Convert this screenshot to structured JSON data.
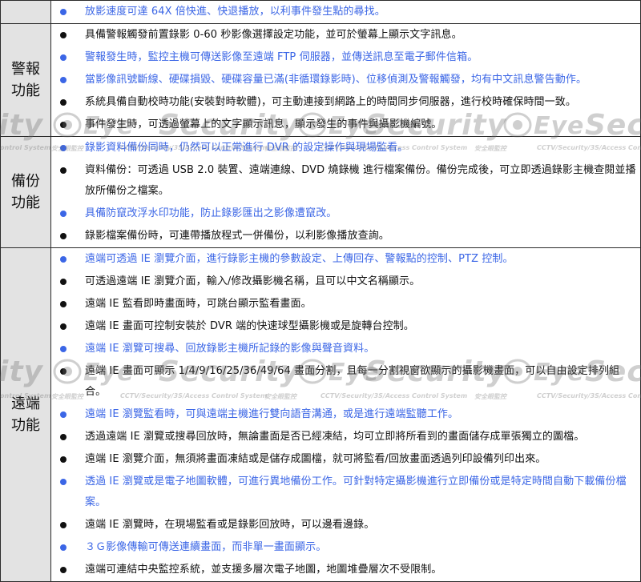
{
  "rows": [
    {
      "category": "",
      "items": [
        {
          "text": "放影速度可達 64X 倍快進、快退播放，以利事件發生點的尋找。",
          "color": "blue"
        }
      ]
    },
    {
      "category": "警報功能",
      "items": [
        {
          "text": "具備警報觸發前置錄影 0-60 秒影像選擇設定功能，並可於螢幕上顯示文字訊息。",
          "color": "black"
        },
        {
          "text": "警報發生時，監控主機可傳送影像至遠端 FTP 伺服器，並傳送訊息至電子郵件信箱。",
          "color": "blue"
        },
        {
          "text": "當影像訊號斷線、硬碟損毀、硬碟容量已滿(非循環錄影時)、位移偵測及警報觸發，均有中文訊息警告動作。",
          "color": "blue"
        },
        {
          "text": "系統具備自動校時功能(安裝對時軟體)，可主動連接到網路上的時間同步伺服器，進行校時確保時間一致。",
          "color": "black"
        },
        {
          "text": "事件發生時，可透過螢幕上的文字顯示訊息，顯示發生的事件與攝影機編號。",
          "color": "black"
        }
      ]
    },
    {
      "category": "備份功能",
      "items": [
        {
          "text": "錄影資料備份同時，仍然可以正常進行 DVR 的設定操作與現場監看。",
          "color": "blue"
        },
        {
          "text": "資料備份：可透過 USB 2.0 裝置、遠端連線、DVD 燒錄機 進行檔案備份。備份完成後，可立即透過錄影主機查閱並播放所備份之檔案。",
          "color": "black"
        },
        {
          "text": "具備防竄改浮水印功能，防止錄影匯出之影像遭竄改。",
          "color": "blue"
        },
        {
          "text": "錄影檔案備份時，可連帶播放程式一併備份，以利影像播放查詢。",
          "color": "black"
        }
      ]
    },
    {
      "category": "遠端功能",
      "items": [
        {
          "text": "遠端可透過 IE 瀏覽介面，進行錄影主機的參數設定、上傳回存、警報點的控制、PTZ 控制。",
          "color": "blue"
        },
        {
          "text": "可透過遠端 IE 瀏覽介面，輸入/修改攝影機名稱，且可以中文名稱顯示。",
          "color": "black"
        },
        {
          "text": "遠端 IE 監看即時畫面時，可跳台顯示監看畫面。",
          "color": "black"
        },
        {
          "text": "遠端 IE 畫面可控制安裝於 DVR 端的快速球型攝影機或是旋轉台控制。",
          "color": "black"
        },
        {
          "text": "遠端 IE 瀏覽可搜尋、回放錄影主機所記錄的影像與聲音資料。",
          "color": "blue"
        },
        {
          "text": "遠端 IE 畫面可顯示 1/4/9/16/25/36/49/64 畫面分割，且每一分割視窗欲顯示的攝影機畫面，可以自由設定排列組合。",
          "color": "black"
        },
        {
          "text": "遠端 IE 瀏覽監看時，可與遠端主機進行雙向語音溝通，或是進行遠端監聽工作。",
          "color": "blue"
        },
        {
          "text": "透過遠端 IE 瀏覽或搜尋回放時，無論畫面是否已經凍結，均可立即將所看到的畫面儲存成單張獨立的圖檔。",
          "color": "black"
        },
        {
          "text": "遠端 IE 瀏覽介面，無須將畫面凍結或是儲存成圖檔，就可將監看/回放畫面透過列印設備列印出來。",
          "color": "black"
        },
        {
          "text": "透過 IE 瀏覽或是電子地圖軟體，可進行異地備份工作。可針對特定攝影機進行立即備份或是特定時間自動下載備份檔案。",
          "color": "blue"
        },
        {
          "text": "遠端 IE 瀏覽時，在現場監看或是錄影回放時，可以邊看邊錄。",
          "color": "black"
        },
        {
          "text": "３Ｇ影像傳輸可傳送連續畫面，而非單一畫面顯示。",
          "color": "blue"
        },
        {
          "text": "遠端可連結中央監控系統，並支援多層次電子地圖，地圖堆疊層次不受限制。",
          "color": "black"
        }
      ]
    }
  ],
  "watermark": {
    "brand": "Security",
    "eye": "Eye",
    "prefix": "ity",
    "suffix": "Sec",
    "tagline_cn": "安全眼監控",
    "tagline_en": "CCTV/Security/3S/Access Control System",
    "tagline_left": "ontrol System"
  },
  "colors": {
    "blue": "#3b66e6",
    "black": "#111111",
    "category_bg": "#e3e3e3"
  }
}
